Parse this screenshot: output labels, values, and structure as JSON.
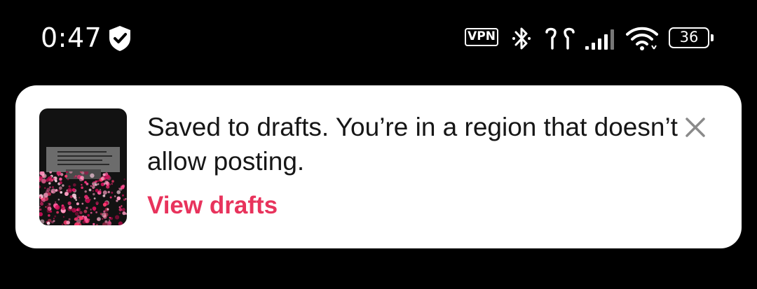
{
  "status_bar": {
    "time": "0:47",
    "vpn_label": "VPN",
    "battery_level": "36",
    "icons": [
      "shield-check-icon",
      "vpn-icon",
      "bluetooth-icon",
      "earbuds-icon",
      "cellular-signal-icon",
      "wifi-icon",
      "battery-icon"
    ]
  },
  "toast": {
    "message": "Saved to drafts. You’re in a region that doesn’t allow posting.",
    "action_label": "View drafts",
    "accent_color": "#e8335c",
    "close_icon": "close-icon",
    "thumbnail_icon": "draft-thumbnail"
  }
}
